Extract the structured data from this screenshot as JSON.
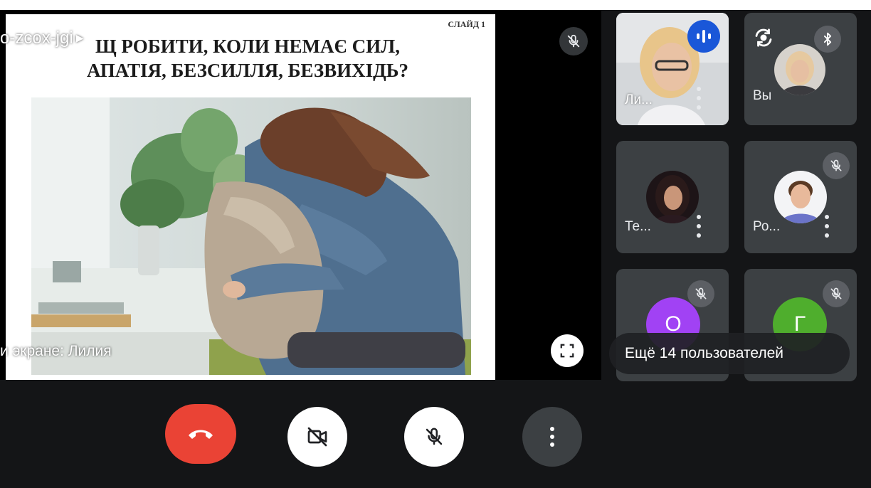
{
  "meeting": {
    "code": "o-zcox-jgi",
    "presenter_caption": "и экране: Лилия",
    "more_users": "Ещё 14 пользователей"
  },
  "slide": {
    "number": "СЛАЙД 1",
    "title_line1": "Щ РОБИТИ, КОЛИ НЕМАЄ СИЛ,",
    "title_line2": "АПАТІЯ, БЕЗСИЛЛЯ, БЕЗВИХІДЬ?"
  },
  "participants": [
    {
      "name": "Ли...",
      "state": "speaking",
      "video": true
    },
    {
      "name": "Вы",
      "state": "self"
    },
    {
      "name": "Те...",
      "state": "unmuted"
    },
    {
      "name": "Ро...",
      "state": "muted"
    },
    {
      "initial": "О",
      "state": "muted",
      "color": "#a142f4"
    },
    {
      "initial": "Г",
      "state": "muted",
      "color": "#4fae2d"
    }
  ],
  "icons": {
    "present_mute": "mic-off-icon",
    "fullscreen": "fullscreen-icon",
    "rotate": "camera-rotate-icon",
    "bluetooth": "bluetooth-icon",
    "speaking": "audio-level-icon",
    "hangup": "phone-hangup-icon",
    "camera": "camera-off-icon",
    "mic": "mic-off-icon",
    "more": "more-vert-icon"
  },
  "colors": {
    "hangup": "#ea4335",
    "speaking": "#1a57d8",
    "tile_bg": "#3c4043",
    "avatar_o": "#a142f4",
    "avatar_g": "#4fae2d"
  }
}
